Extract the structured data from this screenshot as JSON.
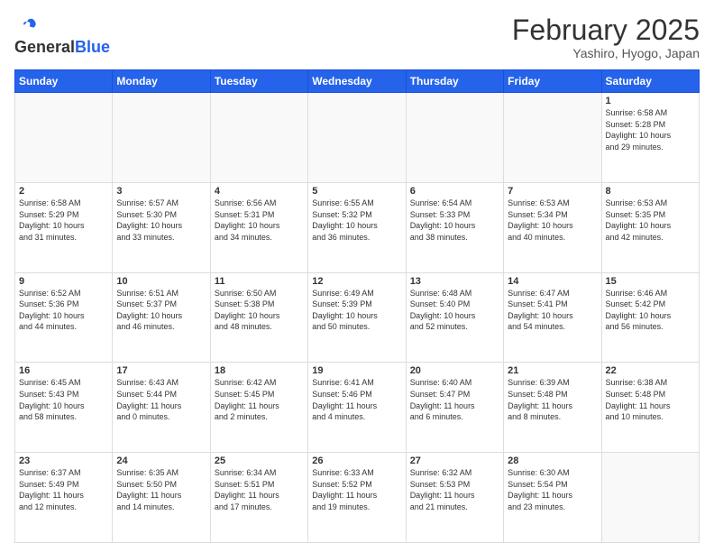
{
  "header": {
    "logo_general": "General",
    "logo_blue": "Blue",
    "month_title": "February 2025",
    "location": "Yashiro, Hyogo, Japan"
  },
  "days_of_week": [
    "Sunday",
    "Monday",
    "Tuesday",
    "Wednesday",
    "Thursday",
    "Friday",
    "Saturday"
  ],
  "weeks": [
    [
      {
        "day": "",
        "detail": ""
      },
      {
        "day": "",
        "detail": ""
      },
      {
        "day": "",
        "detail": ""
      },
      {
        "day": "",
        "detail": ""
      },
      {
        "day": "",
        "detail": ""
      },
      {
        "day": "",
        "detail": ""
      },
      {
        "day": "1",
        "detail": "Sunrise: 6:58 AM\nSunset: 5:28 PM\nDaylight: 10 hours\nand 29 minutes."
      }
    ],
    [
      {
        "day": "2",
        "detail": "Sunrise: 6:58 AM\nSunset: 5:29 PM\nDaylight: 10 hours\nand 31 minutes."
      },
      {
        "day": "3",
        "detail": "Sunrise: 6:57 AM\nSunset: 5:30 PM\nDaylight: 10 hours\nand 33 minutes."
      },
      {
        "day": "4",
        "detail": "Sunrise: 6:56 AM\nSunset: 5:31 PM\nDaylight: 10 hours\nand 34 minutes."
      },
      {
        "day": "5",
        "detail": "Sunrise: 6:55 AM\nSunset: 5:32 PM\nDaylight: 10 hours\nand 36 minutes."
      },
      {
        "day": "6",
        "detail": "Sunrise: 6:54 AM\nSunset: 5:33 PM\nDaylight: 10 hours\nand 38 minutes."
      },
      {
        "day": "7",
        "detail": "Sunrise: 6:53 AM\nSunset: 5:34 PM\nDaylight: 10 hours\nand 40 minutes."
      },
      {
        "day": "8",
        "detail": "Sunrise: 6:53 AM\nSunset: 5:35 PM\nDaylight: 10 hours\nand 42 minutes."
      }
    ],
    [
      {
        "day": "9",
        "detail": "Sunrise: 6:52 AM\nSunset: 5:36 PM\nDaylight: 10 hours\nand 44 minutes."
      },
      {
        "day": "10",
        "detail": "Sunrise: 6:51 AM\nSunset: 5:37 PM\nDaylight: 10 hours\nand 46 minutes."
      },
      {
        "day": "11",
        "detail": "Sunrise: 6:50 AM\nSunset: 5:38 PM\nDaylight: 10 hours\nand 48 minutes."
      },
      {
        "day": "12",
        "detail": "Sunrise: 6:49 AM\nSunset: 5:39 PM\nDaylight: 10 hours\nand 50 minutes."
      },
      {
        "day": "13",
        "detail": "Sunrise: 6:48 AM\nSunset: 5:40 PM\nDaylight: 10 hours\nand 52 minutes."
      },
      {
        "day": "14",
        "detail": "Sunrise: 6:47 AM\nSunset: 5:41 PM\nDaylight: 10 hours\nand 54 minutes."
      },
      {
        "day": "15",
        "detail": "Sunrise: 6:46 AM\nSunset: 5:42 PM\nDaylight: 10 hours\nand 56 minutes."
      }
    ],
    [
      {
        "day": "16",
        "detail": "Sunrise: 6:45 AM\nSunset: 5:43 PM\nDaylight: 10 hours\nand 58 minutes."
      },
      {
        "day": "17",
        "detail": "Sunrise: 6:43 AM\nSunset: 5:44 PM\nDaylight: 11 hours\nand 0 minutes."
      },
      {
        "day": "18",
        "detail": "Sunrise: 6:42 AM\nSunset: 5:45 PM\nDaylight: 11 hours\nand 2 minutes."
      },
      {
        "day": "19",
        "detail": "Sunrise: 6:41 AM\nSunset: 5:46 PM\nDaylight: 11 hours\nand 4 minutes."
      },
      {
        "day": "20",
        "detail": "Sunrise: 6:40 AM\nSunset: 5:47 PM\nDaylight: 11 hours\nand 6 minutes."
      },
      {
        "day": "21",
        "detail": "Sunrise: 6:39 AM\nSunset: 5:48 PM\nDaylight: 11 hours\nand 8 minutes."
      },
      {
        "day": "22",
        "detail": "Sunrise: 6:38 AM\nSunset: 5:48 PM\nDaylight: 11 hours\nand 10 minutes."
      }
    ],
    [
      {
        "day": "23",
        "detail": "Sunrise: 6:37 AM\nSunset: 5:49 PM\nDaylight: 11 hours\nand 12 minutes."
      },
      {
        "day": "24",
        "detail": "Sunrise: 6:35 AM\nSunset: 5:50 PM\nDaylight: 11 hours\nand 14 minutes."
      },
      {
        "day": "25",
        "detail": "Sunrise: 6:34 AM\nSunset: 5:51 PM\nDaylight: 11 hours\nand 17 minutes."
      },
      {
        "day": "26",
        "detail": "Sunrise: 6:33 AM\nSunset: 5:52 PM\nDaylight: 11 hours\nand 19 minutes."
      },
      {
        "day": "27",
        "detail": "Sunrise: 6:32 AM\nSunset: 5:53 PM\nDaylight: 11 hours\nand 21 minutes."
      },
      {
        "day": "28",
        "detail": "Sunrise: 6:30 AM\nSunset: 5:54 PM\nDaylight: 11 hours\nand 23 minutes."
      },
      {
        "day": "",
        "detail": ""
      }
    ]
  ]
}
